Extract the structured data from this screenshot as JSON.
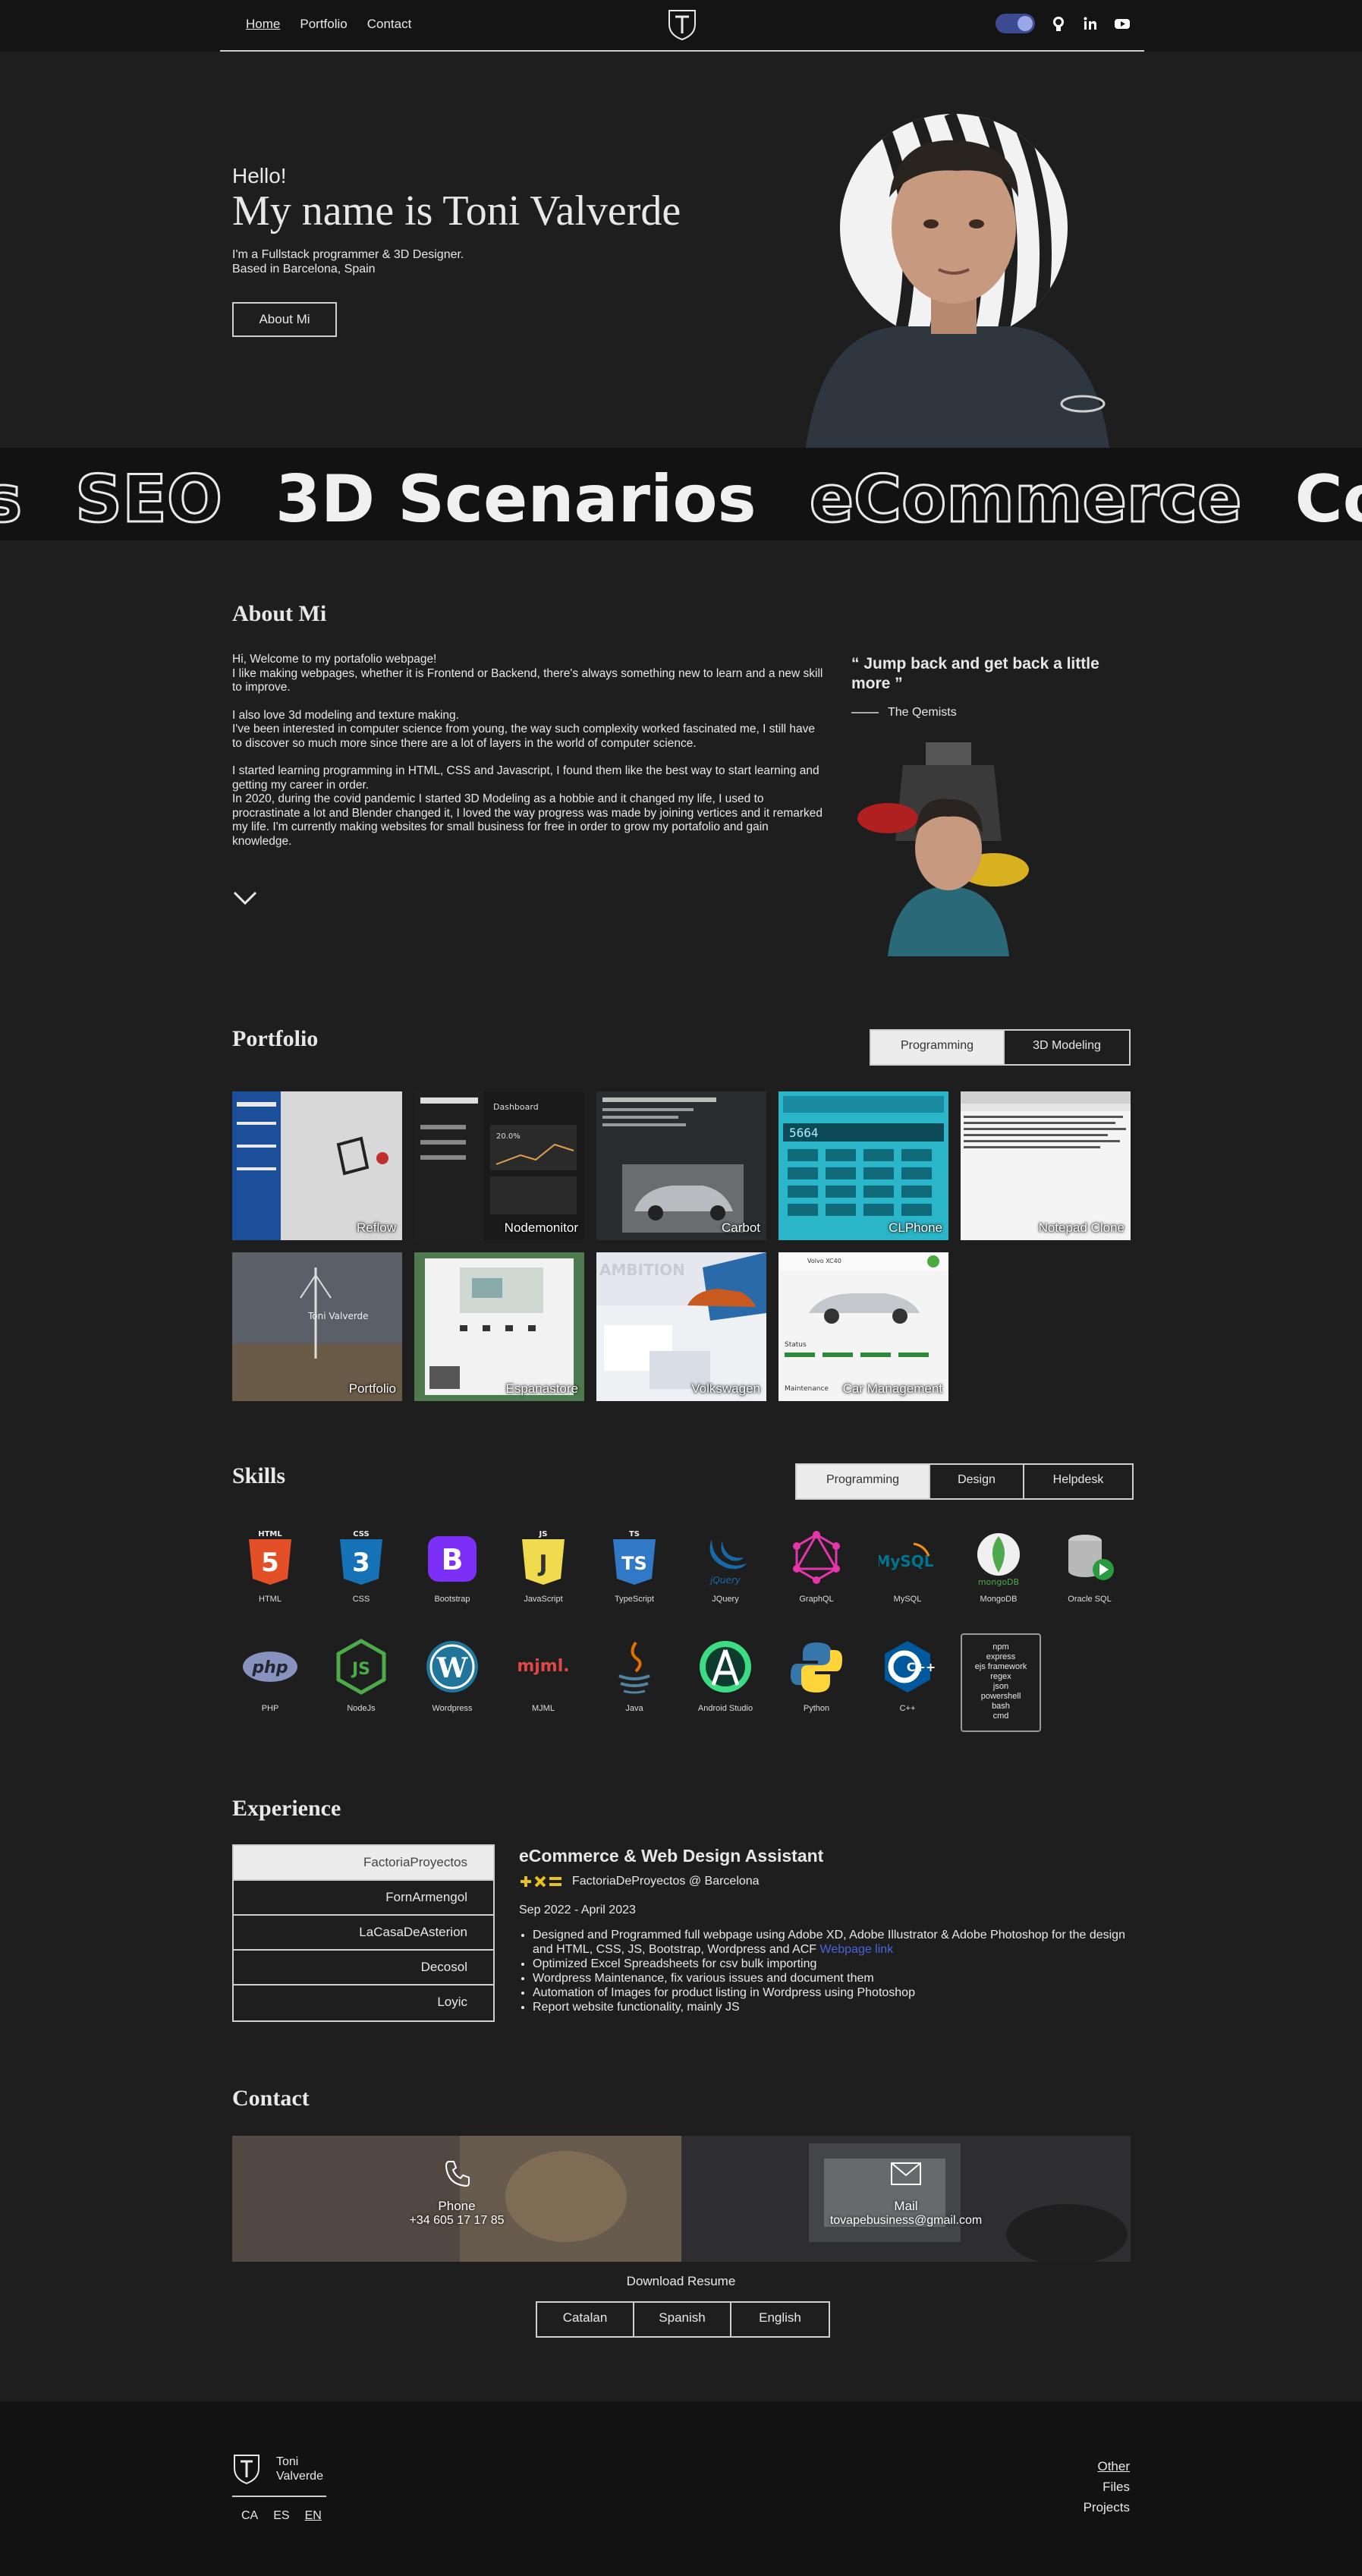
{
  "nav": {
    "links": [
      "Home",
      "Portfolio",
      "Contact"
    ],
    "icons": [
      "theme-toggle",
      "github-icon",
      "linkedin-icon",
      "youtube-icon"
    ]
  },
  "hero": {
    "hello": "Hello!",
    "name": "My name is Toni Valverde",
    "line1": "I'm a Fullstack programmer & 3D Designer.",
    "line2": "Based in Barcelona, Spain",
    "button": "About Mi"
  },
  "marquee": [
    "s",
    "SEO",
    "3D Scenarios",
    "eCommerce",
    "Codin"
  ],
  "about": {
    "title": "About Mi",
    "paragraphs": [
      "Hi, Welcome to my portafolio webpage!\nI like making webpages, whether it is Frontend or Backend, there's always something new to learn and a new skill to improve.",
      "I also love 3d modeling and texture making.\nI've been interested in computer science from young, the way such complexity worked fascinated me, I still have to discover so much more since there are a lot of layers in the world of computer science.",
      "I started learning programming in HTML, CSS and Javascript, I found them like the best way to start learning and getting my career in order.\nIn 2020, during the covid pandemic I started 3D Modeling as a hobbie and it changed my life, I used to procrastinate a lot and Blender changed it, I loved the way progress was made by joining vertices and it remarked my life. I'm currently making websites for small business for free in order to grow my portafolio and gain knowledge."
    ],
    "quote": "“ Jump back and get back a little more ”",
    "quote_author": "The Qemists"
  },
  "portfolio": {
    "title": "Portfolio",
    "tabs": [
      "Programming",
      "3D Modeling"
    ],
    "items": [
      "Reflow",
      "Nodemonitor",
      "Carbot",
      "CLPhone",
      "Notepad Clone",
      "Portfolio",
      "Espanastore",
      "Volkswagen",
      "Car Management"
    ],
    "portfolio_thumb_text": "Toni Valverde",
    "nodemonitor_header": "Dashboard",
    "nodemonitor_stat": "20.0%",
    "calc_display": "5664",
    "vw_banner": "AMBITION",
    "carmgmt_title": "Volvo XC40",
    "carmgmt_status": "Status",
    "carmgmt_maint": "Maintenance"
  },
  "skills": {
    "title": "Skills",
    "tabs": [
      "Programming",
      "Design",
      "Helpdesk"
    ],
    "row1": [
      "HTML",
      "CSS",
      "Bootstrap",
      "JavaScript",
      "TypeScript",
      "JQuery",
      "GraphQL",
      "MySQL",
      "MongoDB",
      "Oracle SQL"
    ],
    "row2": [
      "PHP",
      "NodeJs",
      "Wordpress",
      "MJML",
      "Java",
      "Android Studio",
      "Python",
      "C++"
    ],
    "extra": [
      "npm",
      "express",
      "ejs framework",
      "regex",
      "json",
      "powershell",
      "bash",
      "cmd"
    ],
    "icon_text": {
      "html_top": "HTML",
      "html_num": "5",
      "css_top": "CSS",
      "css_num": "3",
      "bootstrap": "B",
      "js_top": "JS",
      "ts_top": "TS",
      "js_glyph": "J",
      "ts_glyph": "TS",
      "jquery": "jQuery",
      "mysql": "MySQL",
      "mongodb": "mongoDB",
      "php": "php",
      "node": "JS",
      "wp": "W",
      "mjml": "mjml.",
      "cpp": "C++"
    }
  },
  "experience": {
    "title": "Experience",
    "companies": [
      "FactoriaProyectos",
      "FornArmengol",
      "LaCasaDeAsterion",
      "Decosol",
      "Loyic"
    ],
    "role": "eCommerce & Web Design Assistant",
    "company_line": "FactoriaDeProyectos @ Barcelona",
    "dates": "Sep 2022 - April 2023",
    "bullets": [
      "Designed and Programmed full webpage using Adobe XD, Adobe Illustrator & Adobe Photoshop for the design and HTML, CSS, JS, Bootstrap, Wordpress and ACF",
      "Optimized Excel Spreadsheets for csv bulk importing",
      "Wordpress Maintenance, fix various issues and document them",
      "Automation of Images for product listing in Wordpress using Photoshop",
      "Report website functionality, mainly JS"
    ],
    "bullet1_link": "Webpage link"
  },
  "contact": {
    "title": "Contact",
    "phone_label": "Phone",
    "phone": "+34 605 17 17 85",
    "mail_label": "Mail",
    "mail": "tovapebusiness@gmail.com",
    "download": "Download Resume",
    "langs": [
      "Catalan",
      "Spanish",
      "English"
    ]
  },
  "footer": {
    "name_line1": "Toni",
    "name_line2": "Valverde",
    "langs": [
      "CA",
      "ES",
      "EN"
    ],
    "links": [
      "Other",
      "Files",
      "Projects"
    ]
  }
}
